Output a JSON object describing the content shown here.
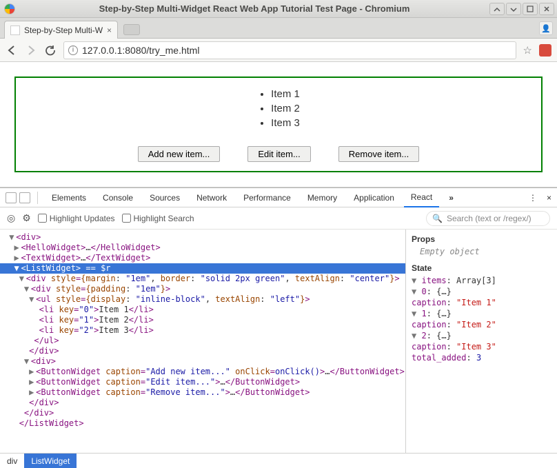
{
  "window": {
    "title": "Step-by-Step Multi-Widget React Web App Tutorial Test Page - Chromium"
  },
  "tab": {
    "title": "Step-by-Step Multi-W"
  },
  "url": "127.0.0.1:8080/try_me.html",
  "page": {
    "items": [
      "Item 1",
      "Item 2",
      "Item 3"
    ],
    "buttons": {
      "add": "Add new item...",
      "edit": "Edit item...",
      "remove": "Remove item..."
    }
  },
  "devtools": {
    "tabs": [
      "Elements",
      "Console",
      "Sources",
      "Network",
      "Performance",
      "Memory",
      "Application",
      "React"
    ],
    "active_tab": "React",
    "toolbar": {
      "highlight_updates": "Highlight Updates",
      "highlight_search": "Highlight Search",
      "search_placeholder": "Search (text or /regex/)"
    },
    "tree": {
      "l0": "<div>",
      "l1_open": "<HelloWidget>",
      "l1_mid": "…",
      "l1_close": "</HelloWidget>",
      "l2_open": "<TextWidget>",
      "l2_mid": "…",
      "l2_close": "</TextWidget>",
      "l3_open": "<ListWidget>",
      "l3_eq": " == ",
      "l3_r": "$r",
      "l4_a": "<div ",
      "l4_b": "style",
      "l4_c": "=",
      "l4_d": "{",
      "l4_e": "margin",
      "l4_f": ": ",
      "l4_g": "\"1em\"",
      "l4_h": ", ",
      "l4_i": "border",
      "l4_j": ": ",
      "l4_k": "\"solid 2px green\"",
      "l4_l": ", ",
      "l4_m": "textAlign",
      "l4_n": ": ",
      "l4_o": "\"center\"",
      "l4_p": "}",
      "l4_q": ">",
      "l5_a": "<div ",
      "l5_b": "style",
      "l5_c": "=",
      "l5_d": "{",
      "l5_e": "padding",
      "l5_f": ": ",
      "l5_g": "\"1em\"",
      "l5_h": "}",
      "l5_i": ">",
      "l6_a": "<ul ",
      "l6_b": "style",
      "l6_c": "=",
      "l6_d": "{",
      "l6_e": "display",
      "l6_f": ": ",
      "l6_g": "\"inline-block\"",
      "l6_h": ", ",
      "l6_i": "textAlign",
      "l6_j": ": ",
      "l6_k": "\"left\"",
      "l6_l": "}",
      "l6_m": ">",
      "li0_a": "<li ",
      "li0_b": "key",
      "li0_c": "=",
      "li0_d": "\"0\"",
      "li0_e": ">",
      "li0_f": "Item 1",
      "li0_g": "</li>",
      "li1_a": "<li ",
      "li1_b": "key",
      "li1_c": "=",
      "li1_d": "\"1\"",
      "li1_e": ">",
      "li1_f": "Item 2",
      "li1_g": "</li>",
      "li2_a": "<li ",
      "li2_b": "key",
      "li2_c": "=",
      "li2_d": "\"2\"",
      "li2_e": ">",
      "li2_f": "Item 3",
      "li2_g": "</li>",
      "ul_close": "</ul>",
      "div_close": "</div>",
      "div_open": "<div>",
      "bw_a": "<ButtonWidget ",
      "bw_cap": "caption",
      "bw_eq": "=",
      "bw0_val": "\"Add new item...\"",
      "bw_sp": " ",
      "bw_oc": "onClick",
      "bw_oc_val": "onClick()",
      "bw_end": ">",
      "bw_mid": "…",
      "bw_close": "</ButtonWidget>",
      "bw1_val": "\"Edit item...\"",
      "bw2_val": "\"Remove item...\"",
      "lw_close": "</ListWidget>"
    },
    "side": {
      "props_label": "Props",
      "props_empty": "Empty object",
      "state_label": "State",
      "items_key": "items",
      "items_val": "Array[3]",
      "idx0": "0",
      "idx1": "1",
      "idx2": "2",
      "obj": "{…}",
      "caption_key": "caption",
      "cap0": "\"Item 1\"",
      "cap1": "\"Item 2\"",
      "cap2": "\"Item 3\"",
      "total_key": "total_added",
      "total_val": "3"
    },
    "crumbs": {
      "root": "div",
      "active": "ListWidget"
    }
  }
}
